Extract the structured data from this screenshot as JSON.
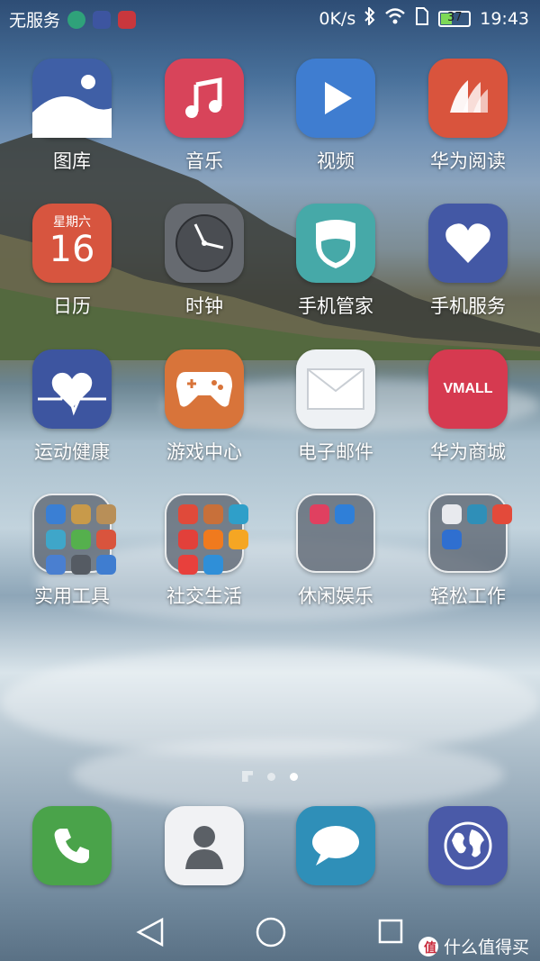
{
  "status_bar": {
    "carrier": "无服务",
    "speed": "0K/s",
    "battery": "37",
    "time": "19:43"
  },
  "apps": [
    {
      "label": "图库",
      "icon": "gallery-icon",
      "color": "#3f5fa6"
    },
    {
      "label": "音乐",
      "icon": "music-icon",
      "color": "#d8445a"
    },
    {
      "label": "视频",
      "icon": "video-play-icon",
      "color": "#3f7dd0"
    },
    {
      "label": "华为阅读",
      "icon": "book-icon",
      "color": "#d9543d"
    },
    {
      "label": "日历",
      "icon": "calendar-icon",
      "color": "#d7553f",
      "day": "星期六",
      "date": "16"
    },
    {
      "label": "时钟",
      "icon": "clock-icon",
      "color": "#666a70"
    },
    {
      "label": "手机管家",
      "icon": "shield-icon",
      "color": "#46a9a8"
    },
    {
      "label": "手机服务",
      "icon": "heart-icon",
      "color": "#4358a5"
    },
    {
      "label": "运动健康",
      "icon": "heart-pulse-icon",
      "color": "#3d55a0"
    },
    {
      "label": "游戏中心",
      "icon": "gamepad-icon",
      "color": "#d8743a"
    },
    {
      "label": "电子邮件",
      "icon": "envelope-icon",
      "color": "#eef1f4"
    },
    {
      "label": "华为商城",
      "icon": "vmall-icon",
      "color": "#d63a50",
      "text": "VMALL"
    },
    {
      "label": "实用工具",
      "icon": "folder-icon"
    },
    {
      "label": "社交生活",
      "icon": "folder-icon"
    },
    {
      "label": "休闲娱乐",
      "icon": "folder-icon"
    },
    {
      "label": "轻松工作",
      "icon": "folder-icon"
    }
  ],
  "page_indicator": {
    "pages": 3,
    "active": 2
  },
  "dock": [
    {
      "icon": "phone-icon",
      "color": "#4aa34a"
    },
    {
      "icon": "contacts-icon",
      "color": "#f1f2f4"
    },
    {
      "icon": "messages-icon",
      "color": "#2f8fb8"
    },
    {
      "icon": "browser-globe-icon",
      "color": "#4a5aa8"
    }
  ],
  "watermark": "什么值得买"
}
